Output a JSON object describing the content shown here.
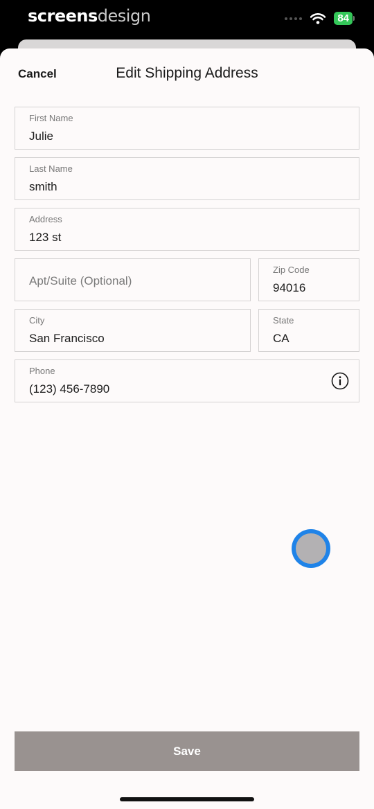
{
  "status_bar": {
    "brand_part1": "screens",
    "brand_part2": "design",
    "battery": "84"
  },
  "header": {
    "cancel_label": "Cancel",
    "title": "Edit Shipping Address"
  },
  "form": {
    "first_name": {
      "label": "First Name",
      "value": "Julie"
    },
    "last_name": {
      "label": "Last Name",
      "value": "smith"
    },
    "address": {
      "label": "Address",
      "value": "123 st"
    },
    "apt": {
      "placeholder": "Apt/Suite (Optional)"
    },
    "zip": {
      "label": "Zip Code",
      "value": "94016"
    },
    "city": {
      "label": "City",
      "value": "San Francisco"
    },
    "state": {
      "label": "State",
      "value": "CA"
    },
    "phone": {
      "label": "Phone",
      "value": "(123) 456-7890",
      "icon": "info-icon"
    }
  },
  "footer": {
    "save_label": "Save"
  },
  "colors": {
    "accent_touch": "#1f83e8",
    "save_button": "#999290",
    "battery": "#34c759"
  }
}
